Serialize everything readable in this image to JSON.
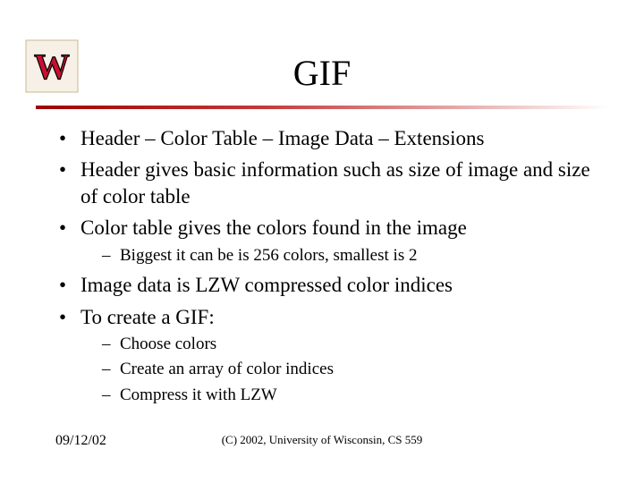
{
  "title": "GIF",
  "bullets": [
    {
      "text": "Header – Color Table – Image Data – Extensions",
      "sub": []
    },
    {
      "text": "Header gives basic information such as size of image and size of color table",
      "sub": []
    },
    {
      "text": "Color table gives the colors found in the image",
      "sub": [
        "Biggest it can be is 256 colors, smallest is 2"
      ]
    },
    {
      "text": "Image data is LZW compressed color indices",
      "sub": []
    },
    {
      "text": "To create a GIF:",
      "sub": [
        "Choose colors",
        "Create an array of color indices",
        "Compress it with LZW"
      ]
    }
  ],
  "footer": {
    "date": "09/12/02",
    "center": "(C) 2002, University of Wisconsin, CS 559"
  },
  "logo": {
    "letter": "W"
  }
}
